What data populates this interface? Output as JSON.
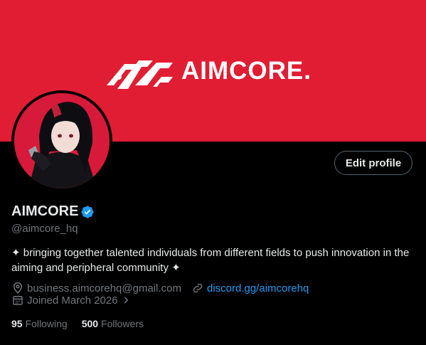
{
  "colors": {
    "banner": "#e11d34",
    "accent_link": "#1d9bf0",
    "verified": "#1d9bf0",
    "muted": "#71767b"
  },
  "banner": {
    "logo_text": "AIMCORE."
  },
  "profile": {
    "edit_button": "Edit profile",
    "name": "AIMCORE",
    "handle": "@aimcore_hq",
    "bio": "✦ bringing together talented individuals from different fields to push innovation in the aiming and peripheral community ✦",
    "email": "business.aimcorehq@gmail.com",
    "website": "discord.gg/aimcorehq",
    "joined": "Joined March 2026",
    "following_count": "95",
    "following_label": "Following",
    "followers_count": "500",
    "followers_label": "Followers"
  },
  "icons": {
    "location": "location-pin-icon",
    "link": "link-icon",
    "calendar": "calendar-icon",
    "chevron": "chevron-right-icon",
    "verified": "verified-badge-icon"
  }
}
